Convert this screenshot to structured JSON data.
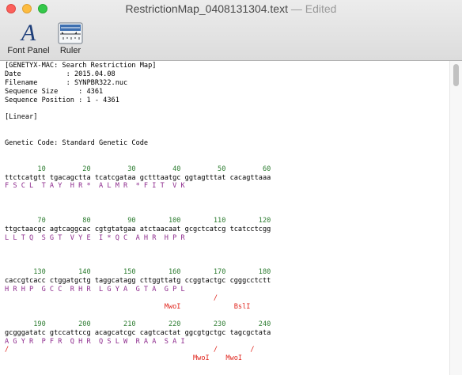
{
  "window": {
    "file_name": "RestrictionMap_0408131304.text",
    "separator": "—",
    "status": "Edited"
  },
  "toolbar": {
    "font_panel_label": "Font Panel",
    "font_panel_glyph": "A",
    "ruler_label": "Ruler"
  },
  "colors": {
    "ruler_numbers": "#2e7d32",
    "amino_acids": "#8e2c8e",
    "enzymes": "#e0261e"
  },
  "document": {
    "lines": [
      {
        "text": "[GENETYX-MAC: Search Restriction Map]",
        "style": "plain"
      },
      {
        "text": "Date           : 2015.04.08",
        "style": "plain"
      },
      {
        "text": "Filename       : SYNPBR322.nuc",
        "style": "plain"
      },
      {
        "text": "Sequence Size     : 4361",
        "style": "plain"
      },
      {
        "text": "Sequence Position : 1 - 4361",
        "style": "plain"
      },
      {
        "text": "",
        "style": "plain"
      },
      {
        "text": "[Linear]",
        "style": "plain"
      },
      {
        "text": "",
        "style": "plain"
      },
      {
        "text": "",
        "style": "plain"
      },
      {
        "text": "Genetic Code: Standard Genetic Code",
        "style": "plain"
      },
      {
        "text": "",
        "style": "plain"
      },
      {
        "text": "",
        "style": "plain"
      },
      {
        "text": "        10         20         30         40         50         60",
        "style": "num"
      },
      {
        "text": "ttctcatgtt tgacagctta tcatcgataa gctttaatgc ggtagtttat cacagttaaa",
        "style": "plain"
      },
      {
        "text": "F S C L  T A Y  H R *  A L M R  * F I T  V K",
        "style": "aa"
      },
      {
        "text": "",
        "style": "plain"
      },
      {
        "text": "",
        "style": "plain"
      },
      {
        "text": "",
        "style": "plain"
      },
      {
        "text": "        70         80         90        100        110        120",
        "style": "num"
      },
      {
        "text": "ttgctaacgc agtcaggcac cgtgtatgaa atctaacaat gcgctcatcg tcatcctcgg",
        "style": "plain"
      },
      {
        "text": "L L T Q  S G T  V Y E  I * Q C  A H R  H P R",
        "style": "aa"
      },
      {
        "text": "",
        "style": "plain"
      },
      {
        "text": "",
        "style": "plain"
      },
      {
        "text": "",
        "style": "plain"
      },
      {
        "text": "       130        140        150        160        170        180",
        "style": "num"
      },
      {
        "text": "caccgtcacc ctggatgctg taggcatagg cttggttatg ccggtactgc cgggcctctt",
        "style": "plain"
      },
      {
        "text": "H R H P  G C C  R H R  L G Y A  G T A  G P L",
        "style": "aa"
      },
      {
        "text": "                                                   /",
        "style": "enz"
      },
      {
        "text": "                                       MwoI             BslI",
        "style": "enz"
      },
      {
        "text": "",
        "style": "plain"
      },
      {
        "text": "       190        200        210        220        230        240",
        "style": "num"
      },
      {
        "text": "gcgggatatc gtccattccg acagcatcgc cagtcactat ggcgtgctgc tagcgctata",
        "style": "plain"
      },
      {
        "text": "A G Y R  P F R  Q H R  Q S L W  R A A  S A I",
        "style": "aa"
      },
      {
        "text": "/                                                  /        /",
        "style": "enz"
      },
      {
        "text": "                                              MwoI    MwoI",
        "style": "enz"
      }
    ]
  }
}
